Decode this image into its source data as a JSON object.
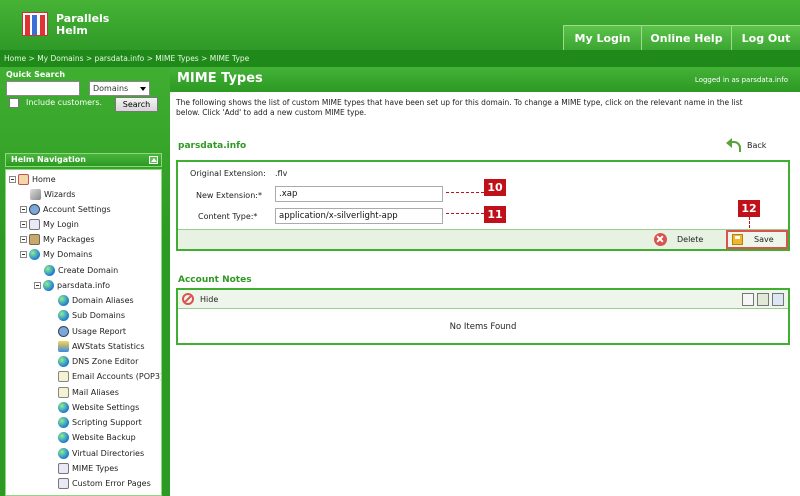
{
  "brand": {
    "line1": "Parallels",
    "line2": "Helm"
  },
  "topnav": {
    "my_login": "My Login",
    "online_help": "Online Help",
    "log_out": "Log Out"
  },
  "breadcrumb": "Home > My Domains > parsdata.info > MIME Types > MIME Type",
  "quick_search": {
    "title": "Quick Search",
    "query_value": "",
    "scope_selected": "Domains",
    "include_customers_label": "Include customers.",
    "include_customers_checked": false,
    "search_button": "Search"
  },
  "nav": {
    "title": "Helm Navigation",
    "items": [
      {
        "label": "Home",
        "icon": "home-icon"
      },
      {
        "label": "Wizards",
        "icon": "wand-icon"
      },
      {
        "label": "Account Settings",
        "icon": "account-settings-icon"
      },
      {
        "label": "My Login",
        "icon": "login-icon"
      },
      {
        "label": "My Packages",
        "icon": "package-icon"
      },
      {
        "label": "My Domains",
        "icon": "globe-icon"
      },
      {
        "label": "Create Domain",
        "icon": "globe-icon"
      },
      {
        "label": "parsdata.info",
        "icon": "globe-icon"
      },
      {
        "label": "Domain Aliases",
        "icon": "globe-icon"
      },
      {
        "label": "Sub Domains",
        "icon": "globe-icon"
      },
      {
        "label": "Usage Report",
        "icon": "gear-icon"
      },
      {
        "label": "AWStats Statistics",
        "icon": "globe-icon"
      },
      {
        "label": "DNS Zone Editor",
        "icon": "globe-icon"
      },
      {
        "label": "Email Accounts (POP3)",
        "icon": "mail-icon"
      },
      {
        "label": "Mail Aliases",
        "icon": "mail-icon"
      },
      {
        "label": "Website Settings",
        "icon": "globe-icon"
      },
      {
        "label": "Scripting Support",
        "icon": "globe-icon"
      },
      {
        "label": "Website Backup",
        "icon": "globe-icon"
      },
      {
        "label": "Virtual Directories",
        "icon": "globe-icon"
      },
      {
        "label": "MIME Types",
        "icon": "mime-icon"
      },
      {
        "label": "Custom Error Pages",
        "icon": "document-icon"
      }
    ]
  },
  "main": {
    "title": "MIME Types",
    "logged_in": "Logged in as parsdata.info",
    "intro": "The following shows the list of custom MIME types that have been set up for this domain. To change a MIME type, click on the relevant name in the list below. Click 'Add' to add a new custom MIME type.",
    "domain_heading": "parsdata.info",
    "back_label": "Back",
    "form": {
      "original_ext_label": "Original Extension:",
      "original_ext_value": ".flv",
      "new_ext_label": "New Extension:*",
      "new_ext_value": ".xap",
      "content_type_label": "Content Type:*",
      "content_type_value": "application/x-silverlight-app",
      "delete_label": "Delete",
      "save_label": "Save"
    },
    "callouts": {
      "c10": "10",
      "c11": "11",
      "c12": "12"
    },
    "notes": {
      "heading": "Account Notes",
      "hide_label": "Hide",
      "empty_text": "No Items Found"
    }
  },
  "colors": {
    "brand_green": "#2f9a27",
    "callout_red": "#c0101a"
  }
}
